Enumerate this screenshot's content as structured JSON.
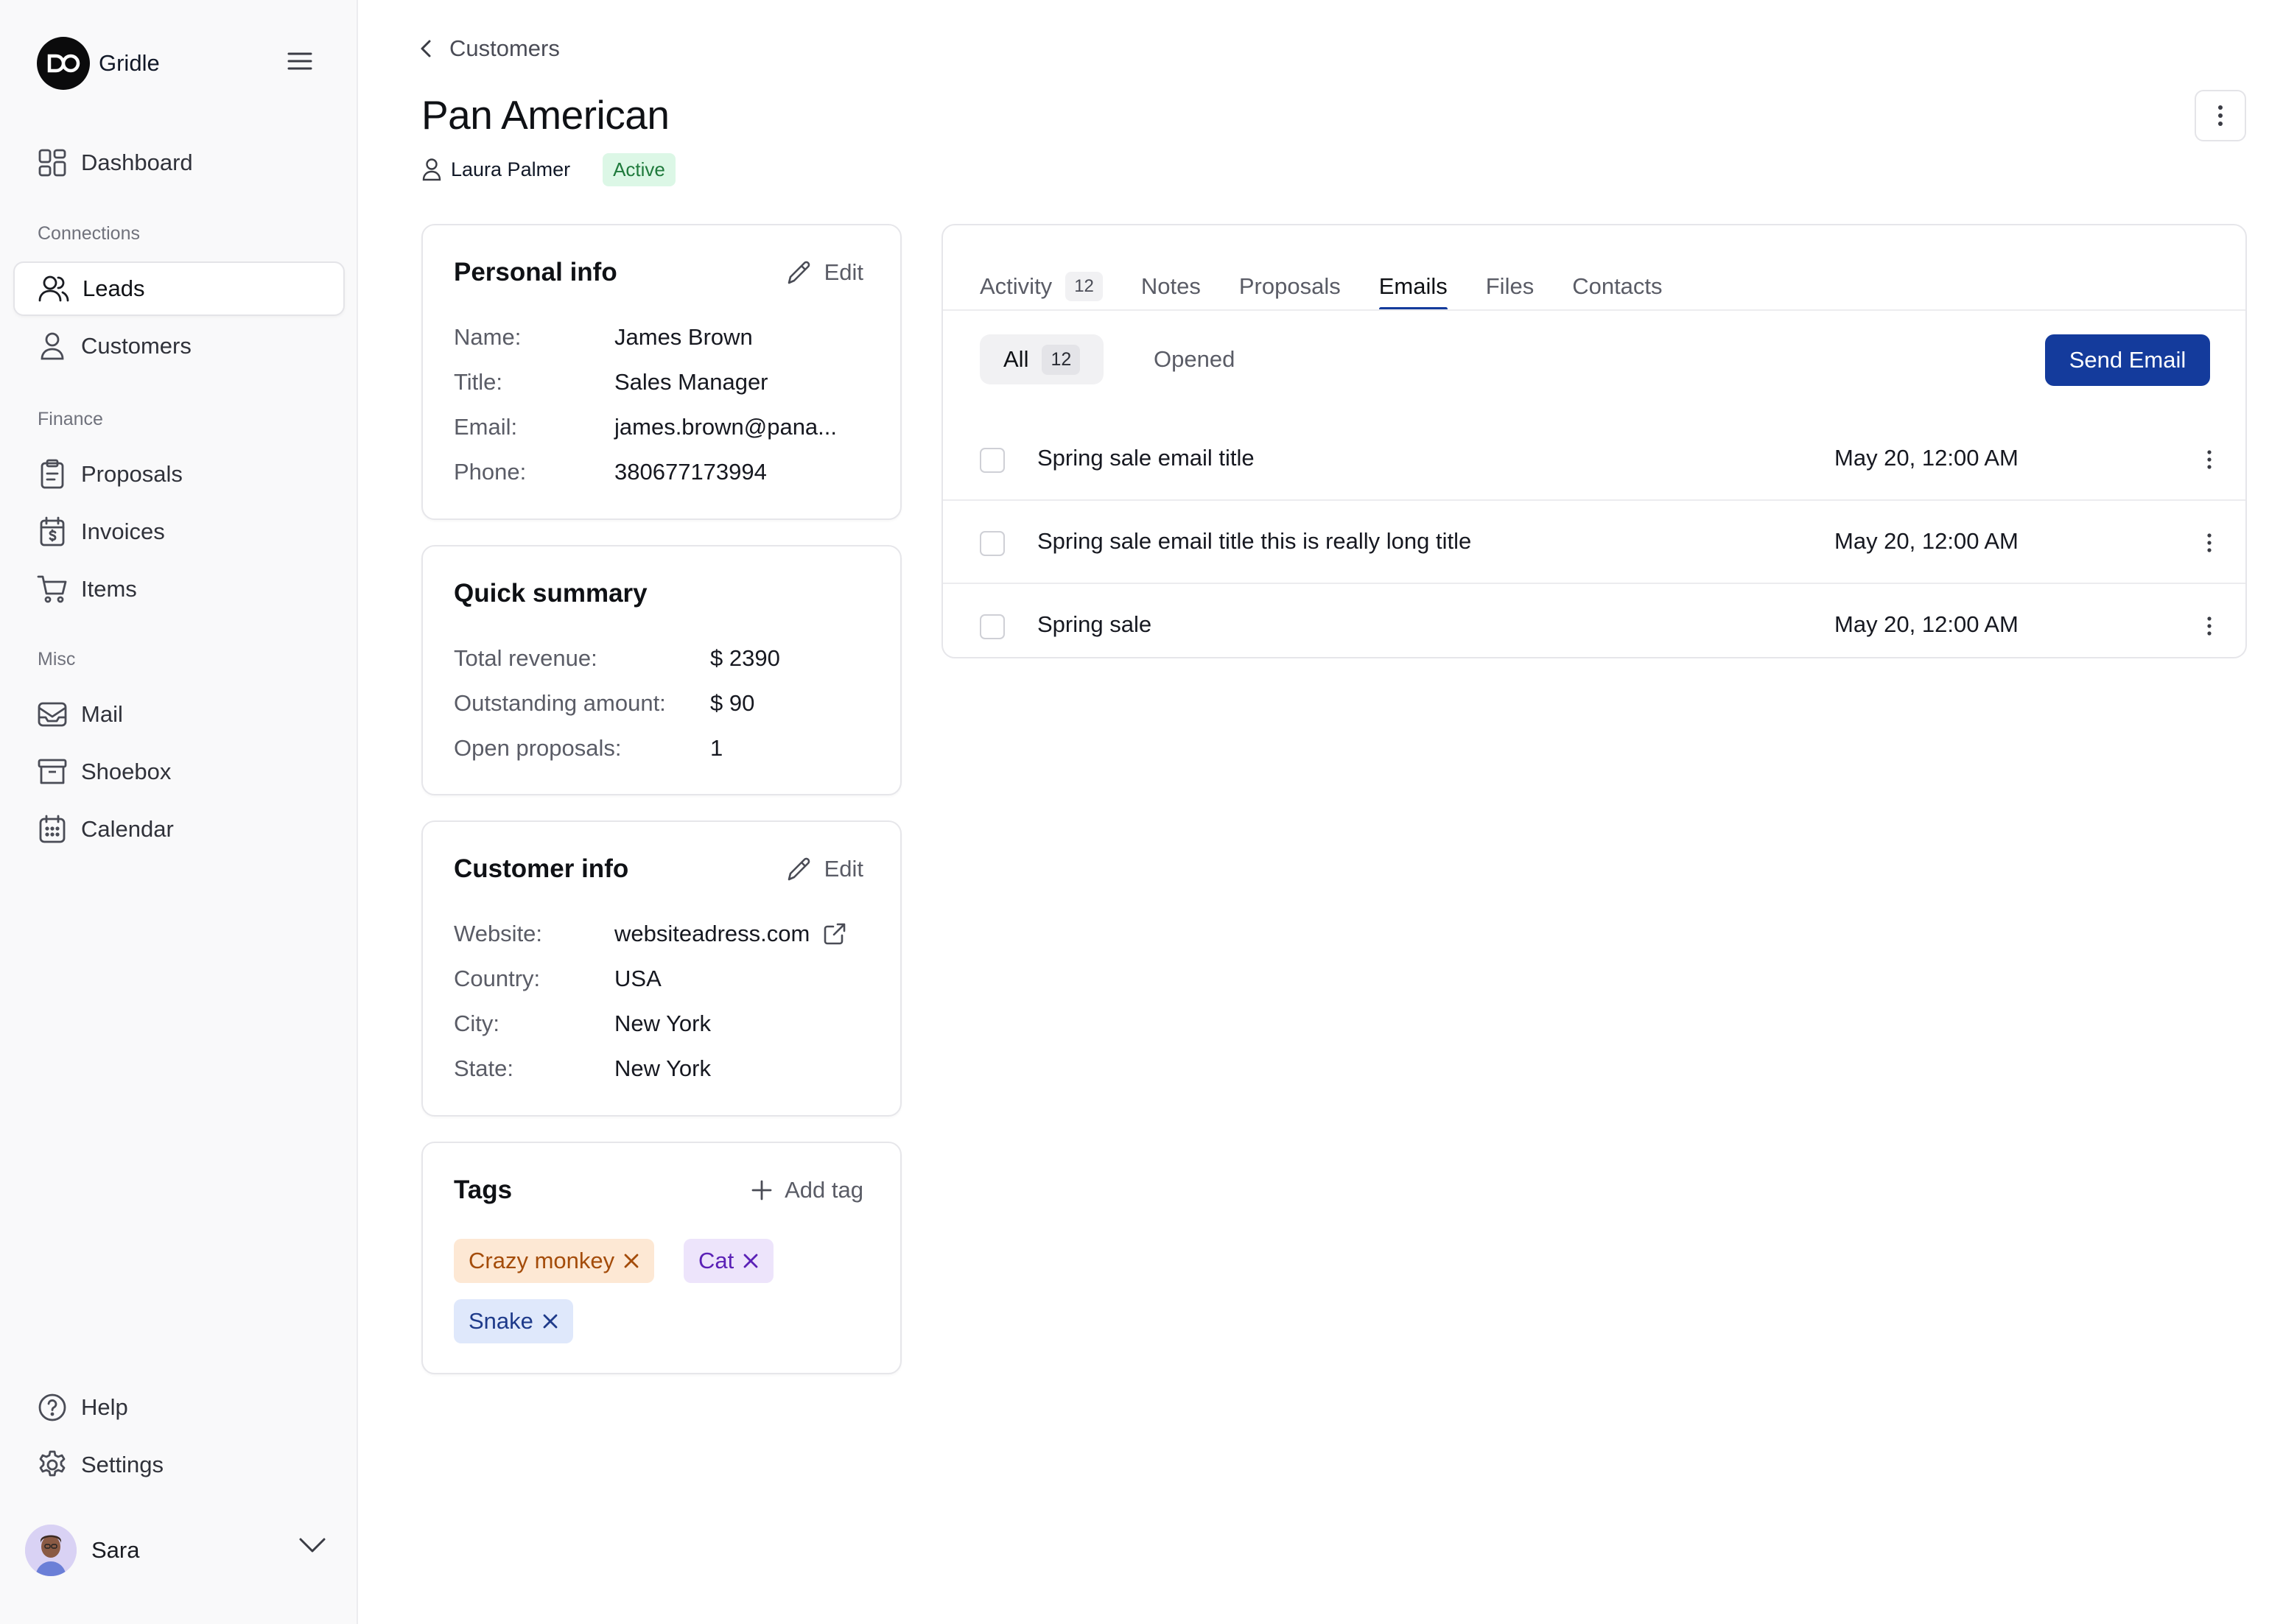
{
  "app": {
    "name": "Gridle"
  },
  "sidebar": {
    "items_top": [
      {
        "label": "Dashboard",
        "icon": "dashboard-icon"
      }
    ],
    "sections": [
      {
        "label": "Connections",
        "items": [
          {
            "label": "Leads",
            "icon": "users-icon",
            "active": true
          },
          {
            "label": "Customers",
            "icon": "user-icon"
          }
        ]
      },
      {
        "label": "Finance",
        "items": [
          {
            "label": "Proposals",
            "icon": "clipboard-icon"
          },
          {
            "label": "Invoices",
            "icon": "invoice-icon"
          },
          {
            "label": "Items",
            "icon": "cart-icon"
          }
        ]
      },
      {
        "label": "Misc",
        "items": [
          {
            "label": "Mail",
            "icon": "mail-icon"
          },
          {
            "label": "Shoebox",
            "icon": "archive-icon"
          },
          {
            "label": "Calendar",
            "icon": "calendar-icon"
          }
        ]
      }
    ],
    "bottom": [
      {
        "label": "Help",
        "icon": "help-icon"
      },
      {
        "label": "Settings",
        "icon": "gear-icon"
      }
    ],
    "user": {
      "name": "Sara"
    }
  },
  "breadcrumb": {
    "label": "Customers"
  },
  "page": {
    "title": "Pan American",
    "owner": "Laura Palmer",
    "status": "Active"
  },
  "personal_info": {
    "title": "Personal info",
    "edit": "Edit",
    "fields": [
      {
        "label": "Name:",
        "value": "James Brown"
      },
      {
        "label": "Title:",
        "value": "Sales Manager"
      },
      {
        "label": "Email:",
        "value": "james.brown@pana..."
      },
      {
        "label": "Phone:",
        "value": "380677173994"
      }
    ]
  },
  "quick_summary": {
    "title": "Quick summary",
    "fields": [
      {
        "label": "Total revenue:",
        "value": "$ 2390"
      },
      {
        "label": "Outstanding amount:",
        "value": "$ 90"
      },
      {
        "label": "Open proposals:",
        "value": "1"
      }
    ]
  },
  "customer_info": {
    "title": "Customer info",
    "edit": "Edit",
    "fields": [
      {
        "label": "Website:",
        "value": "websiteadress.com"
      },
      {
        "label": "Country:",
        "value": "USA"
      },
      {
        "label": "City:",
        "value": "New York"
      },
      {
        "label": "State:",
        "value": "New York"
      }
    ]
  },
  "tags": {
    "title": "Tags",
    "add": "Add tag",
    "items": [
      {
        "label": "Crazy monkey",
        "bg": "#fde8d4",
        "fg": "#a44c0a"
      },
      {
        "label": "Cat",
        "bg": "#ede4fb",
        "fg": "#5b21b6"
      },
      {
        "label": "Snake",
        "bg": "#dfe8fb",
        "fg": "#1e3a8a"
      }
    ]
  },
  "tabs": [
    {
      "label": "Activity",
      "count": "12"
    },
    {
      "label": "Notes"
    },
    {
      "label": "Proposals"
    },
    {
      "label": "Emails",
      "active": true
    },
    {
      "label": "Files"
    },
    {
      "label": "Contacts"
    }
  ],
  "filters": {
    "all": "All",
    "all_count": "12",
    "opened": "Opened"
  },
  "send_button": "Send Email",
  "emails": [
    {
      "title": "Spring sale email title",
      "date": "May 20, 12:00 AM"
    },
    {
      "title": "Spring sale email title this is really long title",
      "date": "May 20, 12:00 AM"
    },
    {
      "title": "Spring sale",
      "date": "May 20, 12:00 AM"
    }
  ],
  "colors": {
    "accent": "#143b9c",
    "status_bg": "#dcf7e6",
    "status_fg": "#1f7a3c"
  }
}
